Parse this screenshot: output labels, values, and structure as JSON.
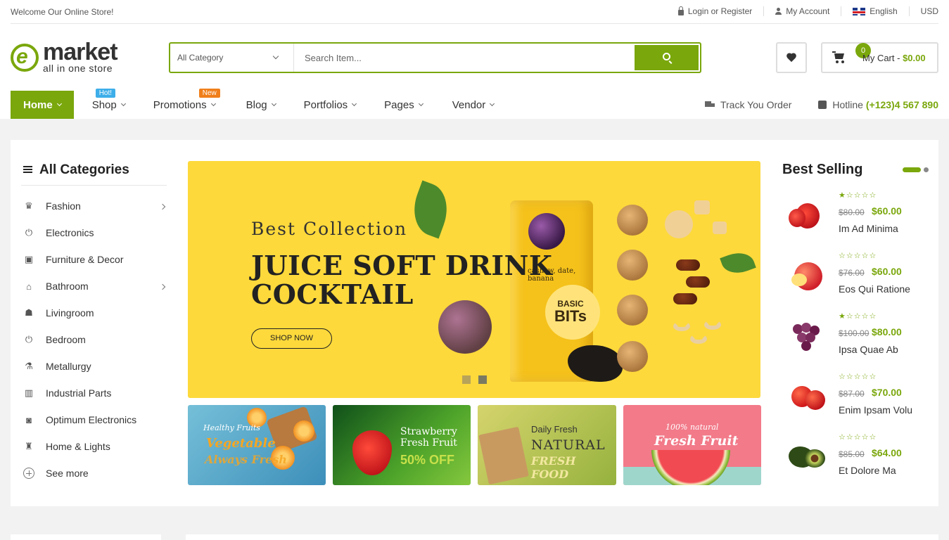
{
  "topbar": {
    "welcome": "Welcome Our Online Store!",
    "login": "Login or Register",
    "account": "My Account",
    "language": "English",
    "currency": "USD"
  },
  "header": {
    "logo_text": "market",
    "logo_tagline": "all in one store",
    "search": {
      "category": "All Category",
      "placeholder": "Search Item..."
    },
    "cart": {
      "count": "0",
      "label": "My Cart - ",
      "total": "$0.00"
    }
  },
  "nav": {
    "items": [
      {
        "label": "Home"
      },
      {
        "label": "Shop",
        "badge": "Hot!"
      },
      {
        "label": "Promotions",
        "badge": "New"
      },
      {
        "label": "Blog"
      },
      {
        "label": "Portfolios"
      },
      {
        "label": "Pages"
      },
      {
        "label": "Vendor"
      }
    ],
    "track": "Track You Order",
    "hotline_label": "Hotline ",
    "hotline_number": "(+123)4 567 890"
  },
  "categories": {
    "title": "All Categories",
    "items": [
      {
        "label": "Fashion",
        "icon": "dress-icon"
      },
      {
        "label": "Electronics",
        "icon": "plug-icon"
      },
      {
        "label": "Furniture & Decor",
        "icon": "wallet-icon"
      },
      {
        "label": "Bathroom",
        "icon": "bathtub-icon"
      },
      {
        "label": "Livingroom",
        "icon": "people-icon"
      },
      {
        "label": "Bedroom",
        "icon": "plug-icon"
      },
      {
        "label": "Metallurgy",
        "icon": "flask-icon"
      },
      {
        "label": "Industrial Parts",
        "icon": "factory-icon"
      },
      {
        "label": "Optimum Electronics",
        "icon": "camera-icon"
      },
      {
        "label": "Home & Lights",
        "icon": "lamp-icon"
      }
    ],
    "see_more": "See more"
  },
  "banner": {
    "subtitle": "Best Collection",
    "title_line1": "JUICE SOFT DRINK",
    "title_line2": "COCKTAIL",
    "button": "SHOP NOW",
    "pouch_text1": "cashew, date,",
    "pouch_text2": "banana",
    "pouch_brand1": "BASIC",
    "pouch_brand2": "BITs"
  },
  "promo_tiles": [
    {
      "line1": "Healthy Fruits",
      "line2": "Vegetable",
      "line3": "Always Fresh"
    },
    {
      "line1": "Strawberry",
      "line2": "Fresh Fruit",
      "line3": "50% OFF"
    },
    {
      "line1": "Daily Fresh",
      "line2": "NATURAL",
      "line3": "FRESH FOOD"
    },
    {
      "line1": "100% natural",
      "line2": "Fresh Fruit"
    }
  ],
  "best_selling": {
    "title": "Best Selling",
    "items": [
      {
        "name": "Im Ad Minima",
        "old_price": "$80.00",
        "price": "$60.00",
        "rating": 1
      },
      {
        "name": "Eos Qui Ratione",
        "old_price": "$76.00",
        "price": "$60.00",
        "rating": 0
      },
      {
        "name": "Ipsa Quae Ab",
        "old_price": "$100.00",
        "price": "$80.00",
        "rating": 1
      },
      {
        "name": "Enim Ipsam Volu",
        "old_price": "$87.00",
        "price": "$70.00",
        "rating": 0
      },
      {
        "name": "Et Dolore Ma",
        "old_price": "$85.00",
        "price": "$64.00",
        "rating": 0
      }
    ]
  },
  "colors": {
    "accent": "#7aa70c",
    "banner_bg": "#fdd93b",
    "hot_badge": "#3daee9",
    "new_badge": "#f07f1b"
  }
}
